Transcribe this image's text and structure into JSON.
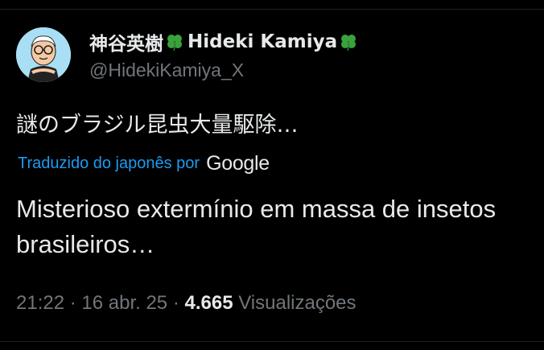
{
  "author": {
    "display_name": "神谷英樹",
    "display_name_latin": "Hideki Kamiya",
    "handle": "@HidekiKamiya_X",
    "name_emoji": "four-leaf-clover-icon",
    "avatar_bg_color": "#a9dff4"
  },
  "tweet": {
    "text": "謎のブラジル昆虫大量駆除…",
    "translated_by_label": "Traduzido do japonês por",
    "translator_name": "Google",
    "translation": "Misterioso extermínio em massa de insetos brasileiros…"
  },
  "meta": {
    "time": "21:22",
    "sep1": " · ",
    "date": "16 abr. 25",
    "sep2": " · ",
    "views_count": "4.665",
    "views_label": " Visualizações"
  },
  "colors": {
    "background": "#000000",
    "text_primary": "#e7e9ea",
    "text_secondary": "#71767b",
    "link_blue": "#1d9bf0",
    "clover_green": "#3aa23a"
  }
}
